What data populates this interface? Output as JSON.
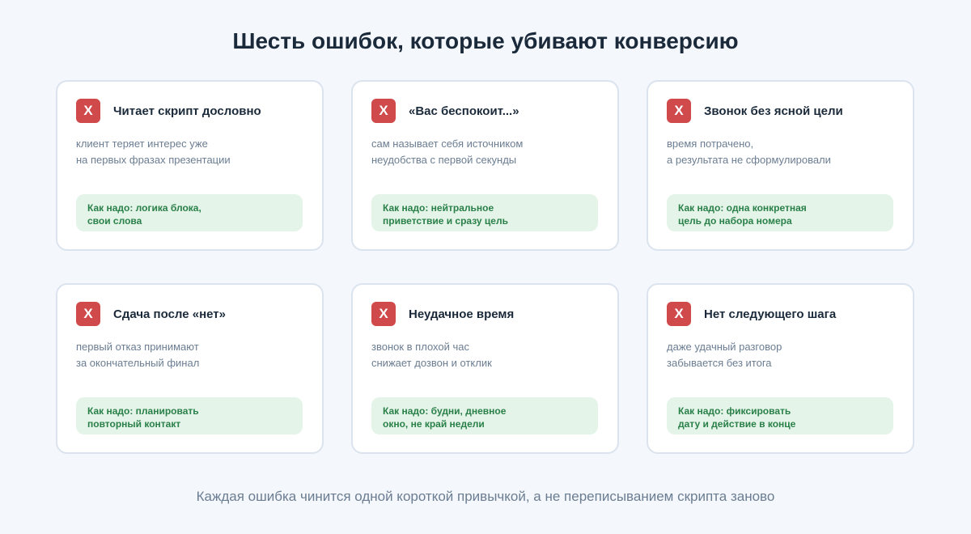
{
  "header": {
    "title": "Шесть ошибок, которые убивают конверсию"
  },
  "cards": [
    {
      "badge": "X",
      "title": "Читает скрипт дословно",
      "desc": [
        "клиент теряет интерес уже",
        "на первых фразах презентации"
      ],
      "fix": [
        "Как надо: логика блока,",
        "свои слова"
      ]
    },
    {
      "badge": "X",
      "title": "«Вас беспокоит...»",
      "desc": [
        "сам называет себя источником",
        "неудобства с первой секунды"
      ],
      "fix": [
        "Как надо: нейтральное",
        "приветствие и сразу цель"
      ]
    },
    {
      "badge": "X",
      "title": "Звонок без ясной цели",
      "desc": [
        "время потрачено,",
        "а результата не сформулировали"
      ],
      "fix": [
        "Как надо: одна конкретная",
        "цель до набора номера"
      ]
    },
    {
      "badge": "X",
      "title": "Сдача после «нет»",
      "desc": [
        "первый отказ принимают",
        "за окончательный финал"
      ],
      "fix": [
        "Как надо: планировать",
        "повторный контакт"
      ]
    },
    {
      "badge": "X",
      "title": "Неудачное время",
      "desc": [
        "звонок в плохой час",
        "снижает дозвон и отклик"
      ],
      "fix": [
        "Как надо: будни, дневное",
        "окно, не край недели"
      ]
    },
    {
      "badge": "X",
      "title": "Нет следующего шага",
      "desc": [
        "даже удачный разговор",
        "забывается без итога"
      ],
      "fix": [
        "Как надо: фиксировать",
        "дату и действие в конце"
      ]
    }
  ],
  "footer": {
    "text": "Каждая ошибка чинится одной короткой привычкой, а не переписыванием скрипта заново"
  },
  "colors": {
    "background": "#f4f7fc",
    "badge": "#d0494b",
    "fix_background": "#e4f4e8",
    "fix_text": "#2a8049",
    "muted_text": "#6b7d92",
    "heading_text": "#1b2a3a"
  },
  "icons": {
    "badge_icon": "cross-mark-icon"
  }
}
